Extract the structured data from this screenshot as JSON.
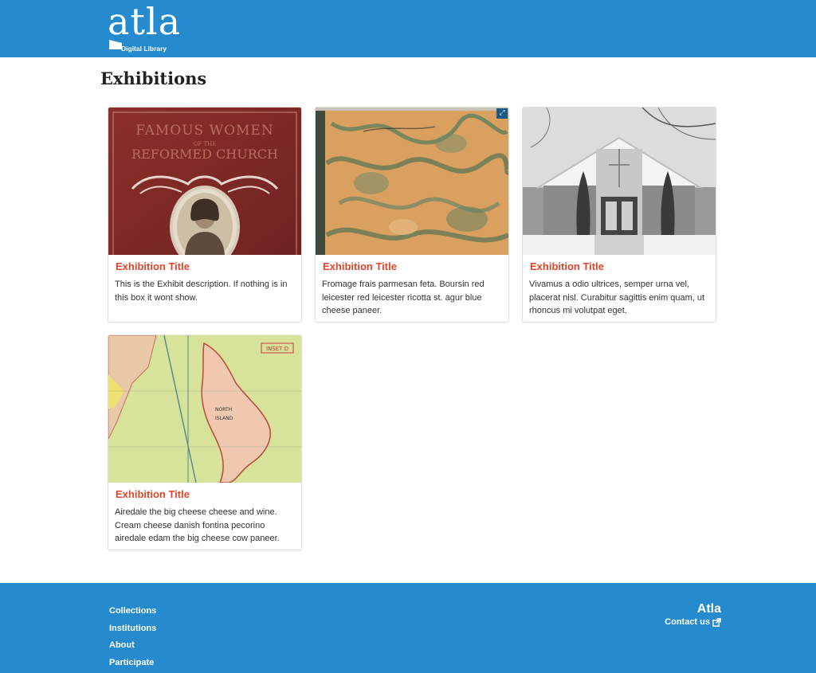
{
  "header": {
    "logo_text": "atla",
    "logo_subtext": "Digital Library",
    "background": "#258bce"
  },
  "page": {
    "title": "Exhibitions"
  },
  "exhibitions": [
    {
      "title": "Exhibition Title",
      "description": "This is the Exhibit description. If nothing is in this box it wont show.",
      "image_caption": "FAMOUS WOMEN OF THE REFORMED CHURCH"
    },
    {
      "title": "Exhibition Title",
      "description": "Fromage frais parmesan feta. Boursin red leicester red leicester ricotta st. agur blue cheese paneer."
    },
    {
      "title": "Exhibition Title",
      "description": "Vivamus a odio ultrices, semper urna vel, placerat nisl. Curabitur sagittis enim quam, ut rhoncus mi volutpat eget."
    },
    {
      "title": "Exhibition Title",
      "description": "Airedale the big cheese cheese and wine. Cream cheese danish fontina pecorino airedale edam the big cheese cow paneer.",
      "map_labels": [
        "INSET D",
        "NORTH",
        "ISLAND"
      ]
    }
  ],
  "expand_icon": "expand-icon",
  "footer": {
    "links": [
      "Collections",
      "Institutions",
      "About",
      "Participate"
    ],
    "brand": "Atla",
    "contact_label": "Contact us",
    "contact_icon": "external-link-icon"
  },
  "colors": {
    "accent": "#e0452a",
    "brand_blue": "#258bce",
    "text": "#333333"
  }
}
